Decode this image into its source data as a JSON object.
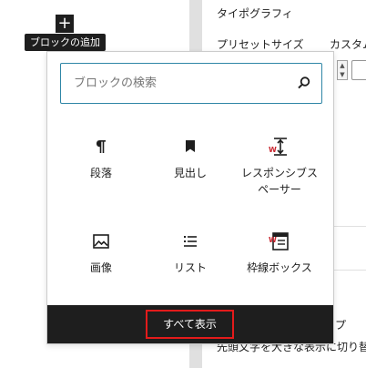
{
  "sidebar": {
    "typography_label": "タイポグラフィ",
    "preset_size_label": "プリセットサイズ",
    "custom_label": "カスタム",
    "cut_text_right": "プ",
    "bottom_text": "先頭文字を大きな表示に切り替"
  },
  "inserter": {
    "plus_symbol": "+",
    "tooltip": "ブロックの追加",
    "search_placeholder": "ブロックの検索",
    "blocks": [
      {
        "label": "段落",
        "icon": "paragraph-icon"
      },
      {
        "label": "見出し",
        "icon": "heading-bookmark-icon"
      },
      {
        "label": "レスポンシブス\nペーサー",
        "icon": "responsive-spacer-icon"
      },
      {
        "label": "画像",
        "icon": "image-icon"
      },
      {
        "label": "リスト",
        "icon": "list-icon"
      },
      {
        "label": "枠線ボックス",
        "icon": "bordered-box-icon"
      }
    ],
    "browse_all": "すべて表示"
  },
  "colors": {
    "dark": "#1e1e1e",
    "focus": "#2f86a6",
    "highlight": "#e31b1b"
  }
}
